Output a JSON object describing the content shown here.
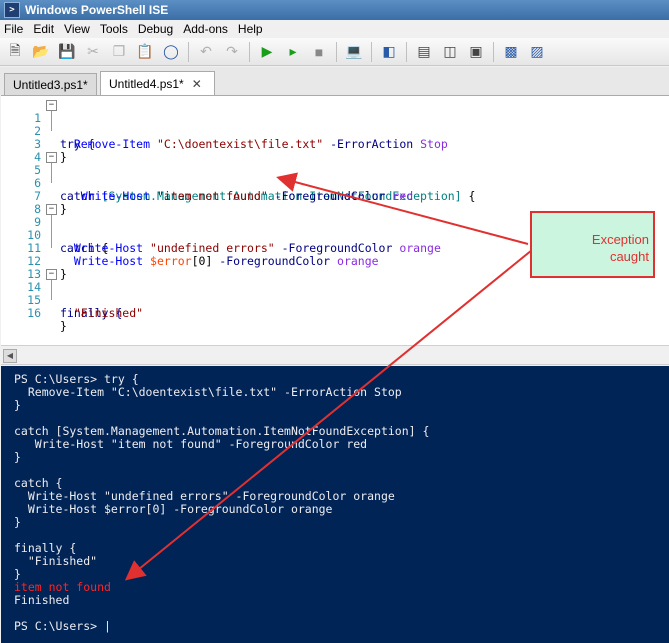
{
  "window": {
    "title": "Windows PowerShell ISE"
  },
  "menu": [
    "File",
    "Edit",
    "View",
    "Tools",
    "Debug",
    "Add-ons",
    "Help"
  ],
  "toolbar": [
    "new-icon",
    "open-icon",
    "save-icon",
    "cut-icon",
    "copy-icon",
    "paste-icon",
    "clear-icon",
    "undo-icon",
    "redo-icon",
    "run-icon",
    "run-selection-icon",
    "stop-icon",
    "remote-icon",
    "powershell-icon",
    "layout-top-icon",
    "layout-right-icon",
    "layout-max-icon",
    "show-script-icon",
    "show-commands-icon"
  ],
  "tabs": [
    {
      "label": "Untitled3.ps1*",
      "active": false
    },
    {
      "label": "Untitled4.ps1*",
      "active": true
    }
  ],
  "editor": {
    "lines": [
      {
        "n": "1",
        "text": "try {"
      },
      {
        "n": "2",
        "text": "  Remove-Item \"C:\\doentexist\\file.txt\" -ErrorAction Stop"
      },
      {
        "n": "3",
        "text": "}"
      },
      {
        "n": "4",
        "text": ""
      },
      {
        "n": "5",
        "text": "catch [System.Management.Automation.ItemNotFoundException] {"
      },
      {
        "n": "6",
        "text": "   Write-Host \"item not found\" -ForegroundColor red"
      },
      {
        "n": "7",
        "text": "}"
      },
      {
        "n": "8",
        "text": ""
      },
      {
        "n": "9",
        "text": "catch {"
      },
      {
        "n": "10",
        "text": "  Write-Host \"undefined errors\" -ForegroundColor orange"
      },
      {
        "n": "11",
        "text": "  Write-Host $error[0] -ForegroundColor orange"
      },
      {
        "n": "12",
        "text": "}"
      },
      {
        "n": "13",
        "text": ""
      },
      {
        "n": "14",
        "text": "finally {"
      },
      {
        "n": "15",
        "text": "  \"Finished\""
      },
      {
        "n": "16",
        "text": "}"
      }
    ]
  },
  "console": {
    "lines": [
      "PS C:\\Users> try {",
      "  Remove-Item \"C:\\doentexist\\file.txt\" -ErrorAction Stop",
      "}",
      "",
      "catch [System.Management.Automation.ItemNotFoundException] {",
      "   Write-Host \"item not found\" -ForegroundColor red",
      "}",
      "",
      "catch {",
      "  Write-Host \"undefined errors\" -ForegroundColor orange",
      "  Write-Host $error[0] -ForegroundColor orange",
      "}",
      "",
      "finally {",
      "  \"Finished\"",
      "}",
      "item not found",
      "Finished",
      "",
      "PS C:\\Users> |"
    ],
    "error_line": "item not found"
  },
  "callout": {
    "text_1": "Exception",
    "text_2": "caught"
  },
  "colors": {
    "console_bg": "#012456",
    "callout_border": "#e03030",
    "callout_bg": "#ccf5e0"
  }
}
